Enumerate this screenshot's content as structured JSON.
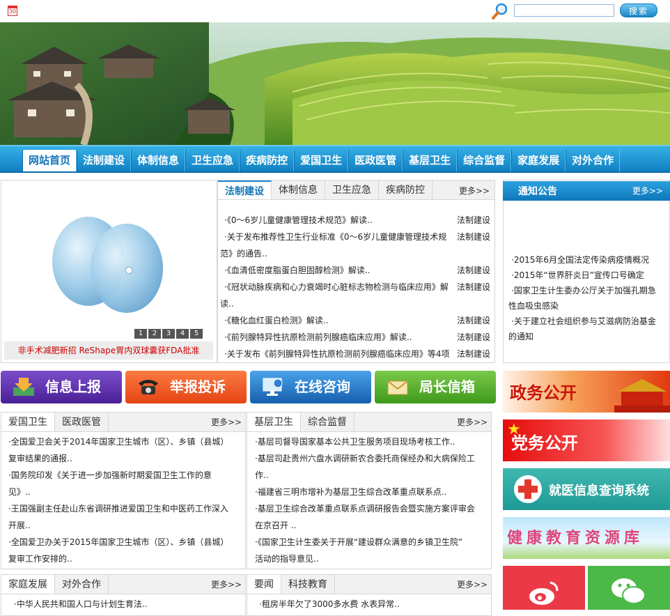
{
  "top": {
    "calendar_label": "30",
    "search_placeholder": "",
    "search_button": "搜索"
  },
  "nav": {
    "items": [
      "网站首页",
      "法制建设",
      "体制信息",
      "卫生应急",
      "疾病防控",
      "爱国卫生",
      "医政医管",
      "基层卫生",
      "综合监督",
      "家庭发展",
      "对外合作"
    ]
  },
  "slider": {
    "caption": "非手术减肥新招 ReShape胃内双球囊获FDA批准",
    "pages": [
      "1",
      "2",
      "3",
      "4",
      "5"
    ]
  },
  "news": {
    "tabs": [
      "法制建设",
      "体制信息",
      "卫生应急",
      "疾病防控"
    ],
    "more": "更多>>",
    "items": [
      {
        "text": "·《0～6岁儿童健康管理技术规范》解读..",
        "cat": "法制建设"
      },
      {
        "text": "·关于发布推荐性卫生行业标准《0～6岁儿童健康管理技术规",
        "text2": "范》的通告..",
        "cat": "法制建设"
      },
      {
        "text": "·《血清低密度脂蛋白胆固醇检测》解读..",
        "cat": "法制建设"
      },
      {
        "text": "·《冠状动脉疾病和心力衰竭时心脏标志物检测与临床应用》解",
        "text2": "读..",
        "cat": "法制建设"
      },
      {
        "text": "·《糖化血红蛋白检测》解读..",
        "cat": "法制建设"
      },
      {
        "text": "·《前列腺特异性抗原检测前列腺癌临床应用》解读..",
        "cat": "法制建设"
      },
      {
        "text": "·关于发布《前列腺特异性抗原检测前列腺癌临床应用》等4项",
        "cat": "法制建设"
      }
    ]
  },
  "notice": {
    "title": "通知公告",
    "more": "更多>>",
    "items": [
      "·2015年6月全国法定传染病疫情概况",
      "·2015年“世界肝炎日”宣传口号确定",
      "·国家卫生计生委办公厅关于加强孔期急",
      "性血吸虫感染",
      "·关于建立社会组织参与艾滋病防治基金",
      "的通知"
    ]
  },
  "buttons": {
    "report": "信息上报",
    "complaint": "举报投诉",
    "consult": "在线咨询",
    "mailbox": "局长信箱"
  },
  "box1": {
    "tabs": [
      "爱国卫生",
      "医政医管"
    ],
    "more": "更多>>",
    "items": [
      "·全国爱卫会关于2014年国家卫生城市（区）、乡镇（县城）",
      "复审结果的通报..",
      "·国务院印发《关于进一步加强新时期爱国卫生工作的意",
      "见》..",
      "·王国强副主任赴山东省调研推进爱国卫生和中医药工作深入",
      "开展..",
      "·全国爱卫办关于2015年国家卫生城市（区）、乡镇（县城）",
      "复审工作安排的.."
    ]
  },
  "box2": {
    "tabs": [
      "基层卫生",
      "综合监督"
    ],
    "more": "更多>>",
    "items": [
      "·基层司督导国家基本公共卫生服务项目现场考核工作..",
      "·基层司赴贵州六盘水调研新农合委托商保经办和大病保险工",
      "作..",
      "·福建省三明市增补为基层卫生综合改革重点联系点..",
      "·基层卫生综合改革重点联系点调研报告会暨实施方案评审会",
      "在京召开 ..",
      "·《国家卫生计生委关于开展“建设群众满意的乡镇卫生院”",
      "活动的指导意见.."
    ]
  },
  "box3": {
    "tabs": [
      "家庭发展",
      "对外合作"
    ],
    "more": "更多>>",
    "items": [
      "·中华人民共和国人口与计划生育法.."
    ]
  },
  "box4": {
    "tabs": [
      "要闻",
      "科技教育"
    ],
    "more": "更多>>",
    "items": [
      "·租房半年欠了3000多水费 水表异常.."
    ]
  },
  "side": {
    "zhengwu": "政务公开",
    "dangwu": "党务公开",
    "jiuyi": "就医信息查询系统",
    "jiankang": "健康教育资源库"
  },
  "colors": {
    "nav_blue": "#1180c3",
    "report_purple": "#5b2fa6",
    "complaint_orange": "#ef5a22",
    "consult_blue": "#1e7fd0",
    "mailbox_green": "#56aa2c"
  }
}
